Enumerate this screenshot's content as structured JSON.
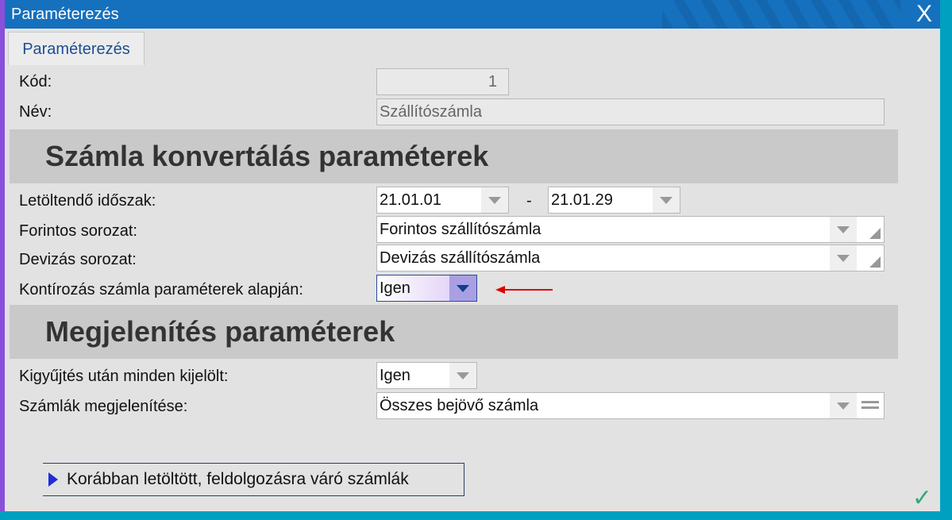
{
  "window": {
    "title": "Paraméterezés",
    "close_label": "X"
  },
  "tab": {
    "label": "Paraméterezés"
  },
  "fields": {
    "kod": {
      "label": "Kód:",
      "value": "1"
    },
    "nev": {
      "label": "Név:",
      "value": "Szállítószámla"
    }
  },
  "section1": {
    "title": "Számla konvertálás paraméterek",
    "period": {
      "label": "Letöltendő időszak:",
      "from": "21.01.01",
      "sep": "-",
      "to": "21.01.29"
    },
    "forint": {
      "label": "Forintos sorozat:",
      "value": "Forintos szállítószámla"
    },
    "deviza": {
      "label": "Devizás sorozat:",
      "value": "Devizás szállítószámla"
    },
    "kontir": {
      "label": "Kontírozás számla paraméterek alapján:",
      "value": "Igen"
    }
  },
  "section2": {
    "title": "Megjelenítés paraméterek",
    "kigyujtes": {
      "label": "Kigyűjtés után minden kijelölt:",
      "value": "Igen"
    },
    "megjelenites": {
      "label": "Számlák megjelenítése:",
      "value": "Összes bejövő számla"
    }
  },
  "expander": {
    "label": "Korábban letöltött, feldolgozásra váró számlák"
  },
  "colors": {
    "titlebar": "#1570be",
    "annotation_arrow": "#e00000",
    "ok": "#3aa57a"
  }
}
